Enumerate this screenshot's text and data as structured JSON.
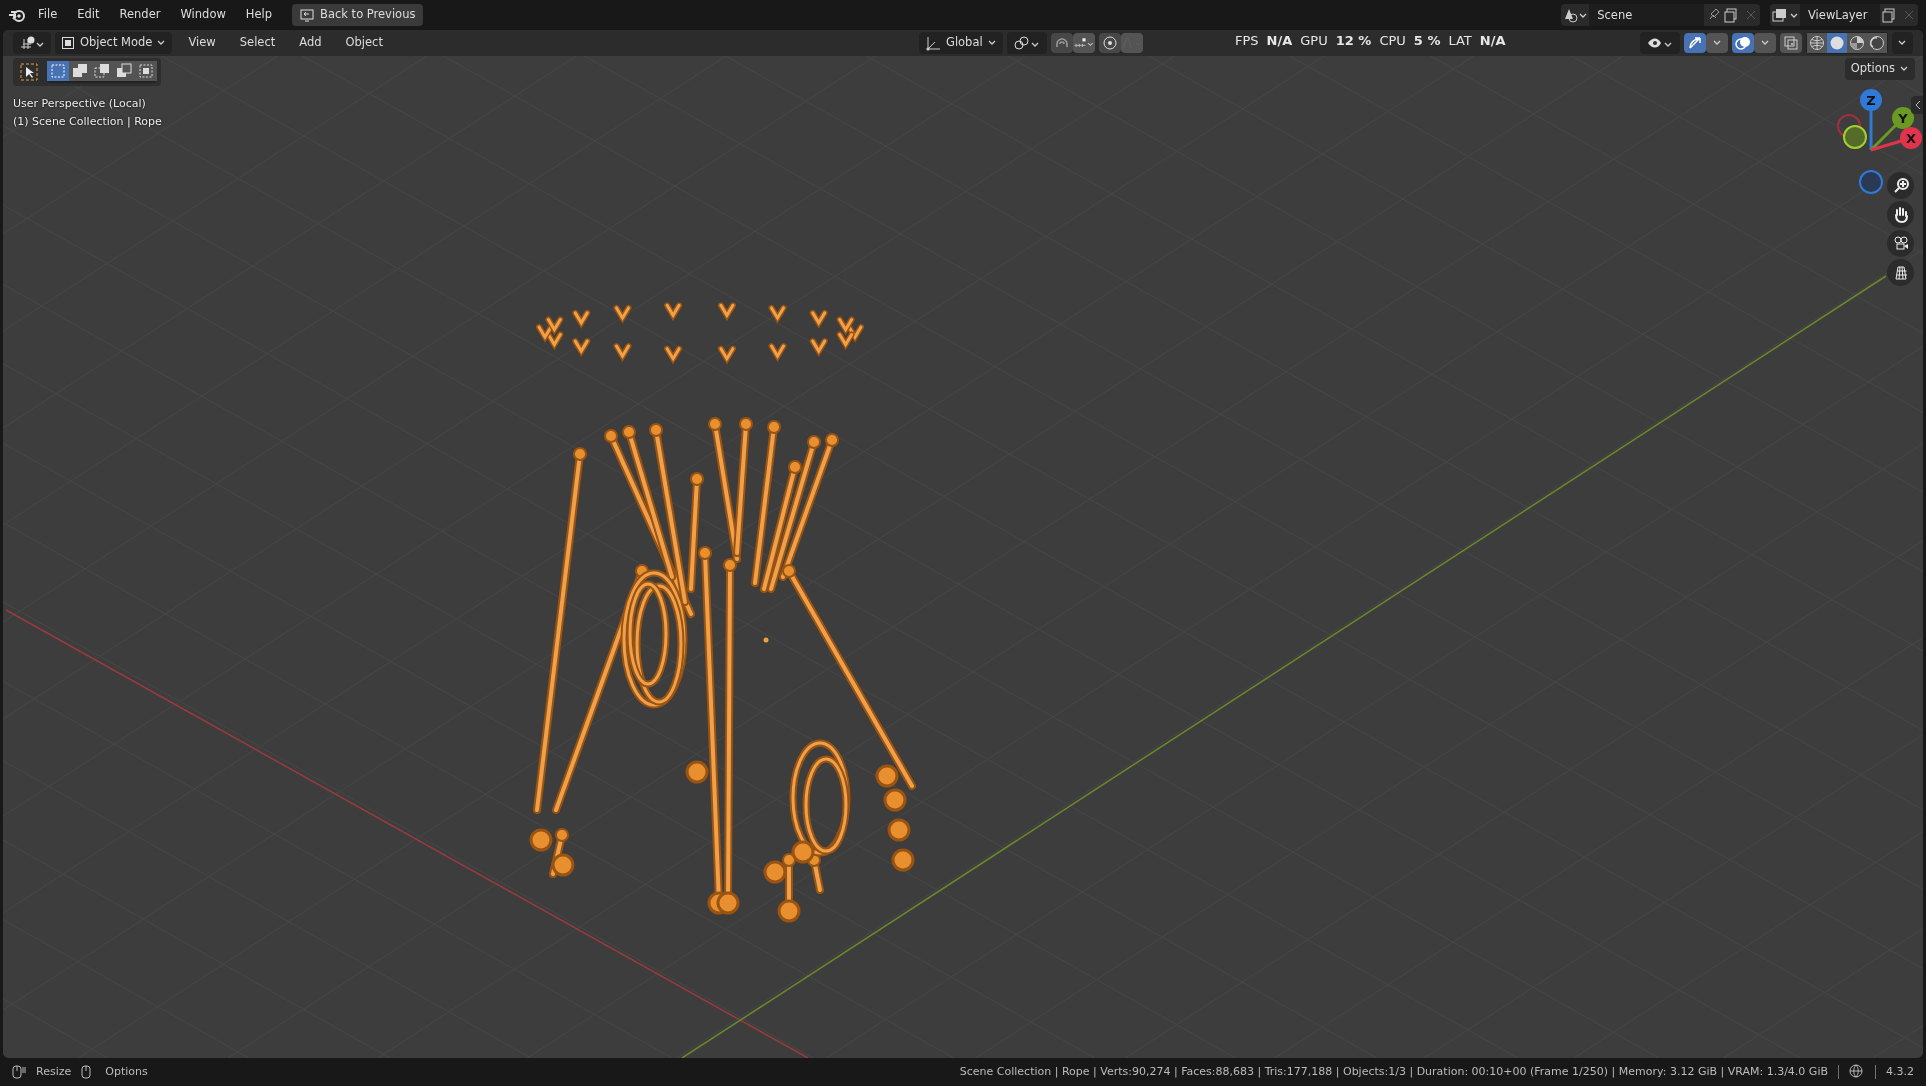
{
  "menubar": {
    "menus": [
      "File",
      "Edit",
      "Render",
      "Window",
      "Help"
    ],
    "back_button": "Back to Previous",
    "scene": {
      "value": "Scene"
    },
    "view_layer": {
      "value": "ViewLayer"
    }
  },
  "header": {
    "mode": "Object Mode",
    "menus": [
      "View",
      "Select",
      "Add",
      "Object"
    ],
    "orientation": "Global",
    "stats": [
      {
        "label": "FPS",
        "value": "N/A"
      },
      {
        "label": "GPU",
        "value": "12 %"
      },
      {
        "label": "CPU",
        "value": "5 %"
      },
      {
        "label": "LAT",
        "value": "N/A"
      }
    ],
    "viewport_toggles": [
      {
        "kind": "gizmos",
        "on": true
      },
      {
        "kind": "overlays",
        "on": true
      },
      {
        "kind": "xray",
        "on": false
      }
    ],
    "shading": [
      {
        "kind": "wireframe",
        "selected": false
      },
      {
        "kind": "solid",
        "selected": true
      },
      {
        "kind": "material",
        "selected": false
      },
      {
        "kind": "rendered",
        "selected": false
      }
    ],
    "options_button": "Options"
  },
  "toolbar": {
    "select_modes": [
      {
        "kind": "set",
        "selected": true
      },
      {
        "kind": "extend",
        "selected": false
      },
      {
        "kind": "subtract",
        "selected": false
      },
      {
        "kind": "invert",
        "selected": false
      },
      {
        "kind": "intersect",
        "selected": false
      }
    ]
  },
  "viewport": {
    "view_name": "User Perspective (Local)",
    "collection": "(1) Scene Collection | Rope",
    "axes": [
      {
        "kind": "z",
        "label": "Z"
      },
      {
        "kind": "y",
        "label": "Y"
      },
      {
        "kind": "x",
        "label": "X"
      }
    ]
  },
  "status_bar": {
    "hints": [
      "Resize",
      "Options"
    ],
    "stats": "Scene Collection | Rope | Verts:90,274 | Faces:88,683 | Tris:177,188 | Objects:1/3 | Duration: 00:10+00 (Frame 1/250) | Memory: 3.12 GiB | VRAM: 1.3/4.0 GiB",
    "version": "4.3.2"
  }
}
